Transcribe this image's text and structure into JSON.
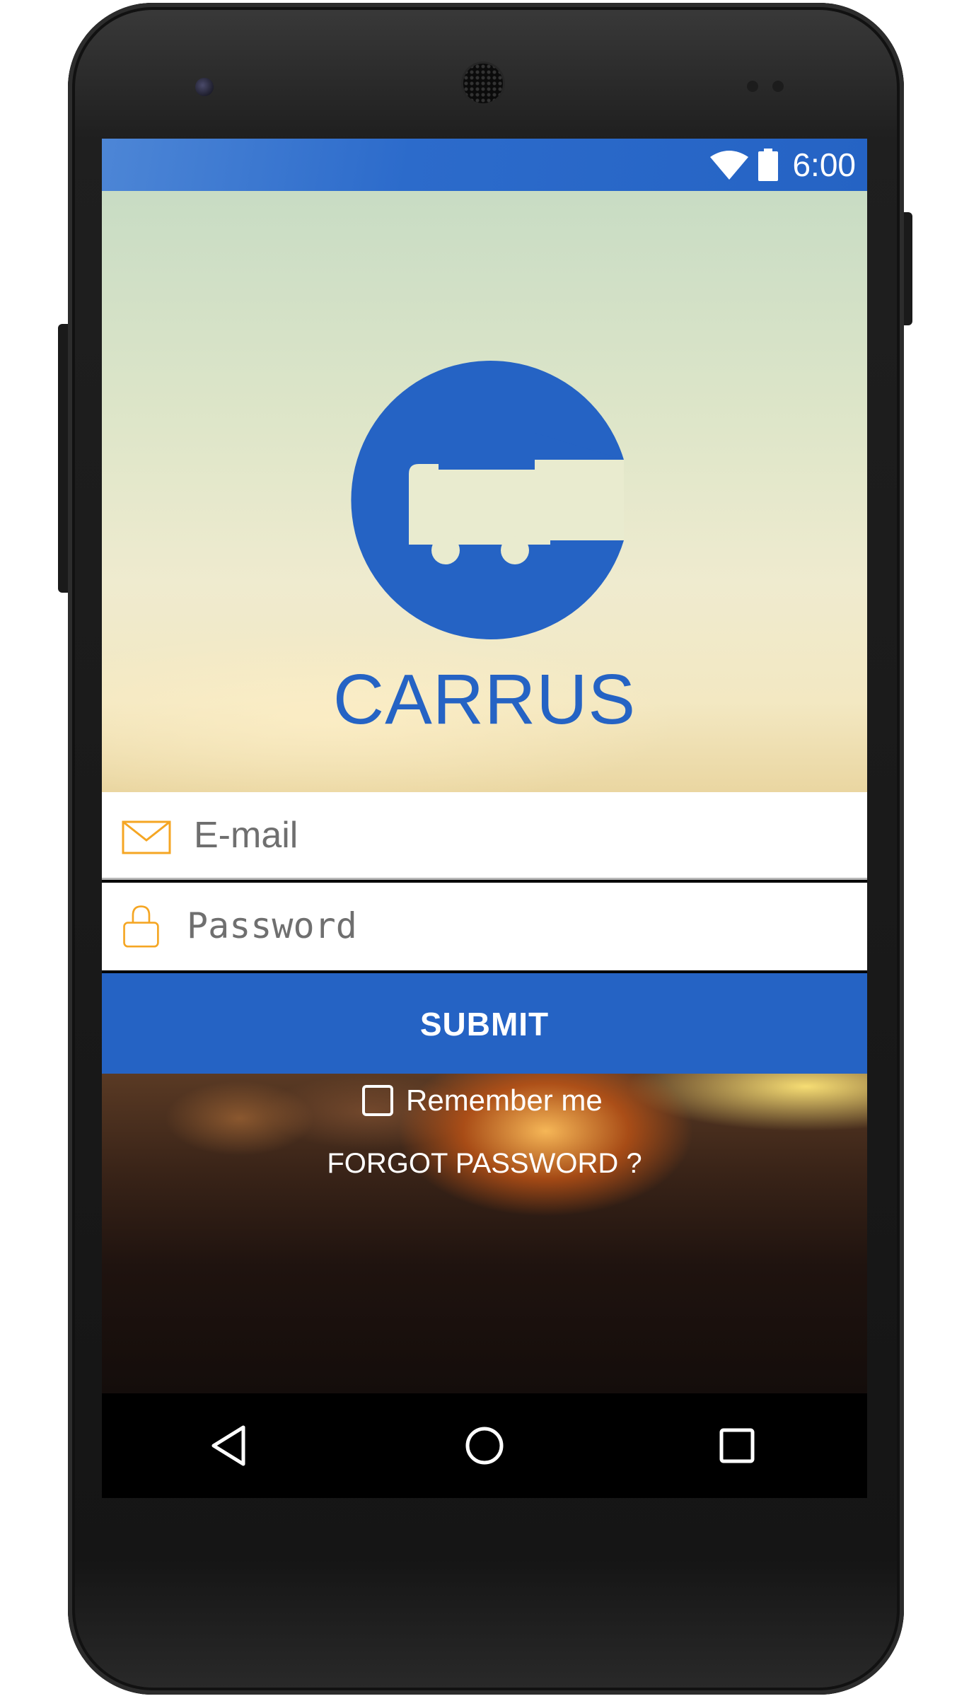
{
  "status_bar": {
    "time": "6:00",
    "icons": [
      "wifi-icon",
      "battery-icon"
    ]
  },
  "brand": {
    "name": "CARRUS",
    "color": "#2563c4",
    "logo_icon": "truck-c-logo"
  },
  "login_form": {
    "email": {
      "placeholder": "E-mail",
      "icon": "envelope-icon",
      "icon_color": "#f5a623"
    },
    "password": {
      "placeholder": "Password",
      "icon": "lock-icon",
      "icon_color": "#f5a623"
    },
    "submit_label": "SUBMIT",
    "remember_label": "Remember me",
    "remember_checked": false,
    "forgot_label": "FORGOT PASSWORD ?"
  },
  "nav_bar": {
    "icons": [
      "back-icon",
      "home-icon",
      "recents-icon"
    ]
  }
}
